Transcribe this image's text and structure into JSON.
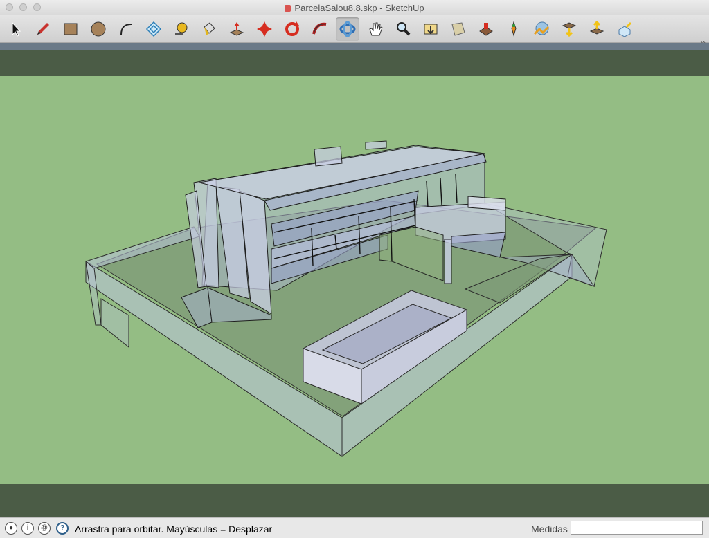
{
  "window": {
    "title": "ParcelaSalou8.8.skp - SketchUp"
  },
  "toolbar": {
    "tools": [
      {
        "name": "Select",
        "icon": "select-arrow-icon"
      },
      {
        "name": "Pencil",
        "icon": "pencil-icon"
      },
      {
        "name": "Rectangle",
        "icon": "rectangle-icon"
      },
      {
        "name": "Circle",
        "icon": "circle-icon"
      },
      {
        "name": "Arc",
        "icon": "arc-icon"
      },
      {
        "name": "Offset",
        "icon": "offset-icon"
      },
      {
        "name": "Tape Measure",
        "icon": "tape-measure-icon"
      },
      {
        "name": "Paint Bucket",
        "icon": "paint-bucket-icon"
      },
      {
        "name": "Push/Pull",
        "icon": "push-pull-icon"
      },
      {
        "name": "Move",
        "icon": "move-icon"
      },
      {
        "name": "Rotate",
        "icon": "rotate-icon"
      },
      {
        "name": "Follow Me",
        "icon": "follow-me-icon"
      },
      {
        "name": "Orbit",
        "icon": "orbit-icon",
        "active": true
      },
      {
        "name": "Pan",
        "icon": "pan-hand-icon"
      },
      {
        "name": "Zoom",
        "icon": "zoom-icon"
      },
      {
        "name": "Zoom Extents",
        "icon": "zoom-extents-icon"
      },
      {
        "name": "Section Plane",
        "icon": "section-plane-icon"
      },
      {
        "name": "Components",
        "icon": "components-icon"
      },
      {
        "name": "Add Location",
        "icon": "add-location-icon"
      },
      {
        "name": "Toggle Terrain",
        "icon": "terrain-icon"
      },
      {
        "name": "Get Models",
        "icon": "get-models-icon"
      },
      {
        "name": "Share Model",
        "icon": "share-model-icon"
      },
      {
        "name": "Share Component",
        "icon": "share-component-icon"
      },
      {
        "name": "Preview in Google Earth",
        "icon": "google-earth-icon"
      }
    ],
    "overflow": "»"
  },
  "viewport": {
    "sky_color": "#4b5c46",
    "ground_color": "#94bd84",
    "model_label": "3D model of house on plot (X-ray view)"
  },
  "status": {
    "text": "Arrastra para orbitar. Mayúsculas = Desplazar",
    "measure_label": "Medidas",
    "measure_value": ""
  }
}
